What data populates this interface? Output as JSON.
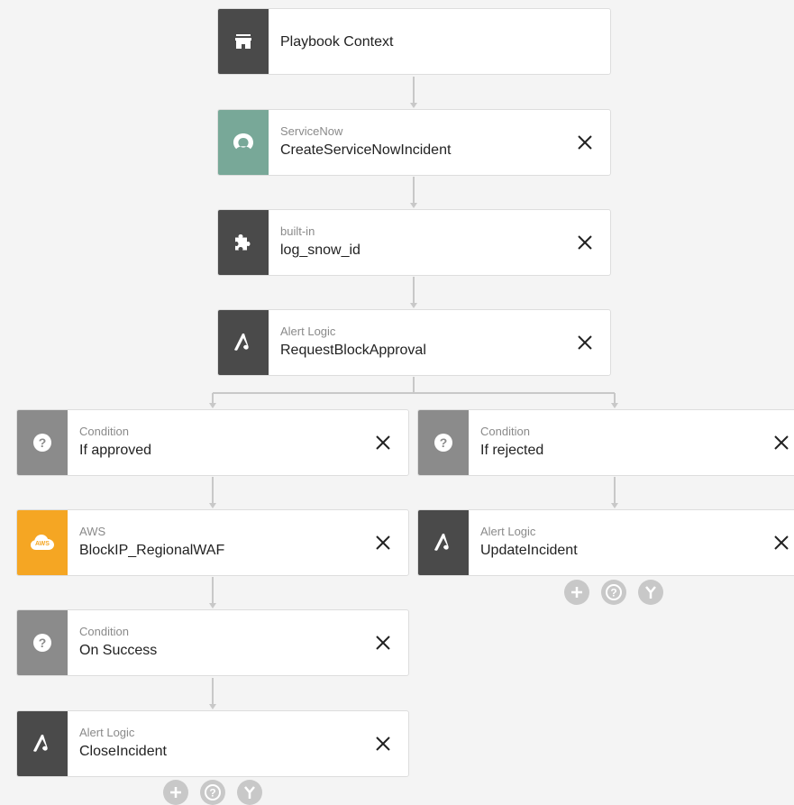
{
  "nodes": {
    "context": {
      "main": "Playbook Context"
    },
    "servicenow": {
      "sub": "ServiceNow",
      "main": "CreateServiceNowIncident"
    },
    "builtin": {
      "sub": "built-in",
      "main": "log_snow_id"
    },
    "approval": {
      "sub": "Alert Logic",
      "main": "RequestBlockApproval"
    },
    "approved": {
      "sub": "Condition",
      "main": "If approved"
    },
    "rejected": {
      "sub": "Condition",
      "main": "If rejected"
    },
    "aws": {
      "sub": "AWS",
      "main": "BlockIP_RegionalWAF",
      "icon_text": "AWS"
    },
    "update": {
      "sub": "Alert Logic",
      "main": "UpdateIncident"
    },
    "success": {
      "sub": "Condition",
      "main": "On Success"
    },
    "close": {
      "sub": "Alert Logic",
      "main": "CloseIncident"
    }
  },
  "icons": {
    "context": "store-icon",
    "servicenow": "servicenow-logo-icon",
    "builtin": "puzzle-piece-icon",
    "alertlogic": "alert-logic-logo-icon",
    "condition": "question-mark-icon",
    "aws": "aws-cloud-icon",
    "close": "close-icon",
    "add": "plus-circle-icon",
    "add_condition": "question-circle-icon",
    "branch": "branch-circle-icon"
  },
  "colors": {
    "dark": "#4a4a4a",
    "servicenow": "#78a898",
    "condition": "#8b8b8b",
    "aws": "#f5a623",
    "connector": "#c8c8c8"
  }
}
